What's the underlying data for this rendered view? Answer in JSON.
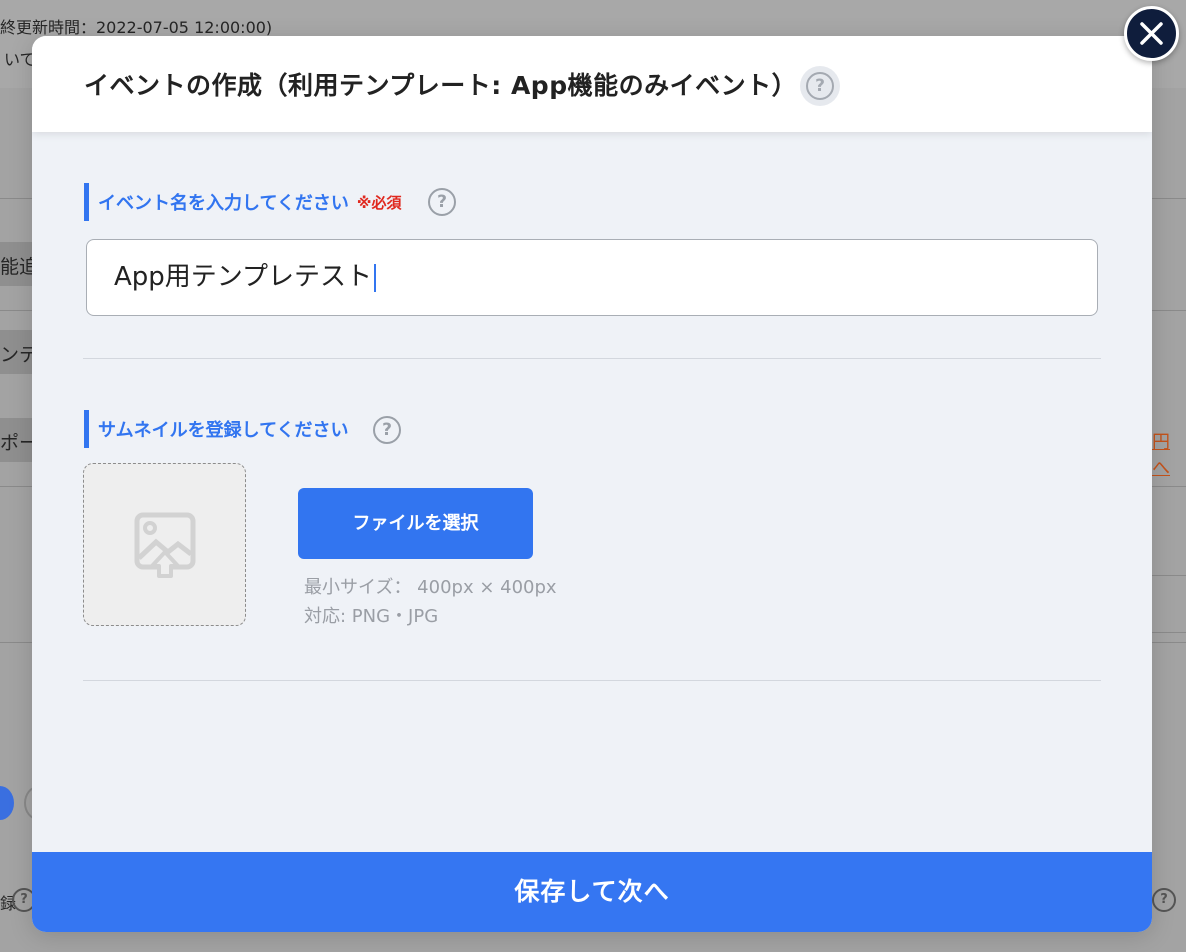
{
  "background_page": {
    "last_updated": "終更新時間：2022-07-05 12:00:00)",
    "line2": "いて",
    "row1": "能追",
    "row2": "ンテ",
    "row3": "ポー",
    "link_text": "円へ",
    "row4": "録"
  },
  "modal": {
    "title": "イベントの作成（利用テンプレート: App機能のみイベント）",
    "help_glyph": "?",
    "event_name": {
      "label": "イベント名を入力してください",
      "required": "※必須",
      "value": "App用テンプレテスト"
    },
    "thumbnail": {
      "label": "サムネイルを登録してください",
      "file_button": "ファイルを選択",
      "min_size": "最小サイズ：  400px × 400px",
      "formats": "対応: PNG・JPG"
    },
    "save_button": "保存して次へ"
  },
  "colors": {
    "accent": "#3275f0",
    "required": "#e0281e",
    "close_bg": "#0f1d3c"
  },
  "icons": [
    "help-icon",
    "image-upload-icon",
    "close-icon"
  ]
}
